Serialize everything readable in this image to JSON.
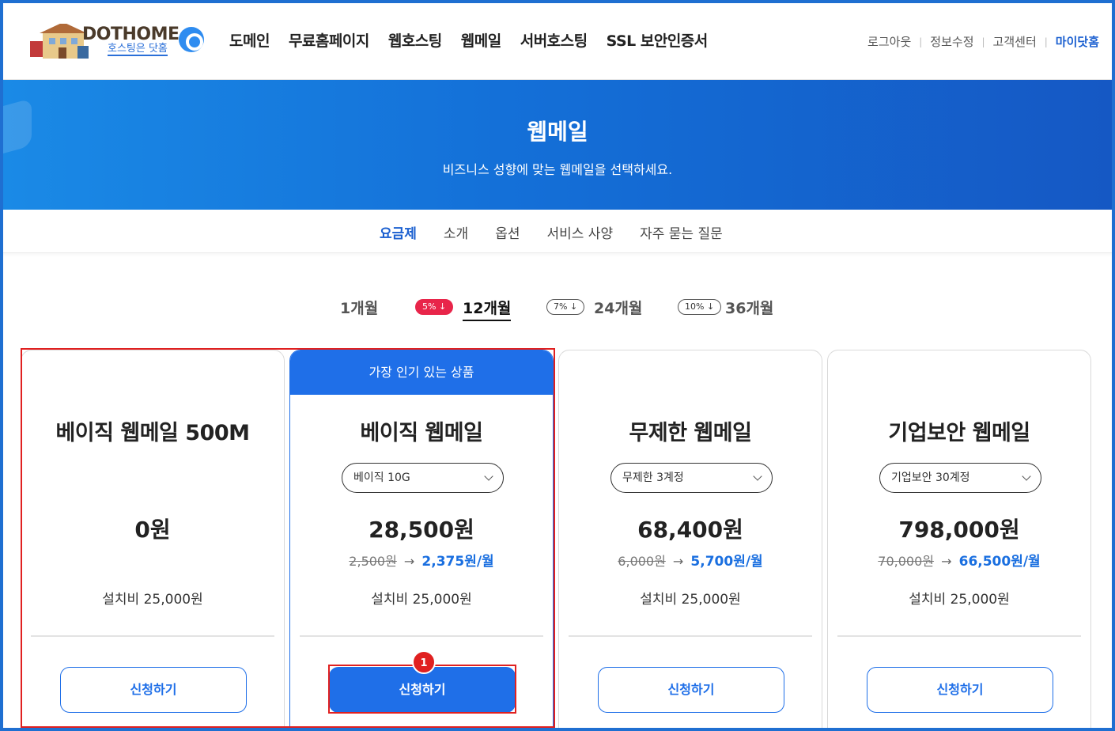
{
  "header": {
    "logo_text": "DOTHOME",
    "logo_sub": "호스팅은 닷홈",
    "nav": [
      "도메인",
      "무료홈페이지",
      "웹호스팅",
      "웹메일",
      "서버호스팅",
      "SSL 보안인증서"
    ],
    "util": {
      "logout": "로그아웃",
      "edit_info": "정보수정",
      "support": "고객센터",
      "my_page": "마이닷홈"
    }
  },
  "hero": {
    "title": "웹메일",
    "subtitle": "비즈니스 성향에 맞는 웹메일을 선택하세요."
  },
  "subtabs": [
    "요금제",
    "소개",
    "옵션",
    "서비스 사양",
    "자주 묻는 질문"
  ],
  "subtab_active": "요금제",
  "periods": [
    {
      "label": "1개월",
      "badge": ""
    },
    {
      "label": "12개월",
      "badge": "5% ↓",
      "active": true
    },
    {
      "label": "24개월",
      "badge": "7% ↓"
    },
    {
      "label": "36개월",
      "badge": "10% ↓"
    }
  ],
  "cards": [
    {
      "title": "베이직 웹메일 500M",
      "select": "",
      "price": "0원",
      "old": "",
      "new": "",
      "setup": "설치비 25,000원",
      "button": "신청하기"
    },
    {
      "banner": "가장 인기 있는 상품",
      "title": "베이직 웹메일",
      "select": "베이직 10G",
      "price": "28,500원",
      "old": "2,500원",
      "new": "2,375원/월",
      "setup": "설치비 25,000원",
      "button": "신청하기"
    },
    {
      "title": "무제한 웹메일",
      "select": "무제한 3계정",
      "price": "68,400원",
      "old": "6,000원",
      "new": "5,700원/월",
      "setup": "설치비 25,000원",
      "button": "신청하기"
    },
    {
      "title": "기업보안 웹메일",
      "select": "기업보안 30계정",
      "price": "798,000원",
      "old": "70,000원",
      "new": "66,500원/월",
      "setup": "설치비 25,000원",
      "button": "신청하기"
    }
  ],
  "arrow": "→",
  "annotation": {
    "marker": "1"
  },
  "colors": {
    "primary": "#1f6fe8",
    "badge_red": "#e8254a",
    "annotation": "#e02020"
  }
}
